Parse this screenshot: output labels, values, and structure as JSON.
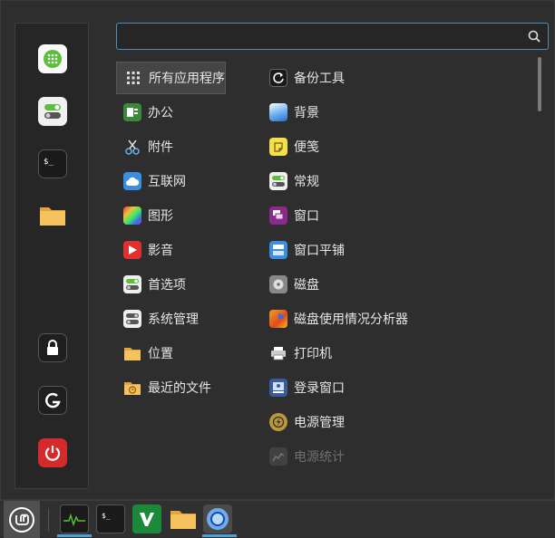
{
  "search": {
    "placeholder": "",
    "value": ""
  },
  "favorites": [
    {
      "name": "calculator",
      "icon": "calculator-icon"
    },
    {
      "name": "settings",
      "icon": "toggle-settings-icon"
    },
    {
      "name": "terminal",
      "icon": "terminal-icon"
    },
    {
      "name": "files",
      "icon": "folder-icon"
    }
  ],
  "system_buttons": [
    {
      "name": "lock",
      "icon": "lock-icon"
    },
    {
      "name": "logout",
      "icon": "logout-icon"
    },
    {
      "name": "shutdown",
      "icon": "power-icon"
    }
  ],
  "categories": [
    {
      "label": "所有应用程序",
      "icon": "grid-icon",
      "active": true
    },
    {
      "label": "办公",
      "icon": "office-icon"
    },
    {
      "label": "附件",
      "icon": "scissors-icon"
    },
    {
      "label": "互联网",
      "icon": "cloud-icon"
    },
    {
      "label": "图形",
      "icon": "graphics-icon"
    },
    {
      "label": "影音",
      "icon": "play-icon"
    },
    {
      "label": "首选项",
      "icon": "preferences-icon"
    },
    {
      "label": "系统管理",
      "icon": "system-admin-icon"
    },
    {
      "label": "位置",
      "icon": "folder-icon"
    },
    {
      "label": "最近的文件",
      "icon": "recent-folder-icon"
    }
  ],
  "apps": [
    {
      "label": "备份工具",
      "icon": "backup-icon"
    },
    {
      "label": "背景",
      "icon": "background-icon"
    },
    {
      "label": "便笺",
      "icon": "sticky-note-icon"
    },
    {
      "label": "常规",
      "icon": "general-icon"
    },
    {
      "label": "窗口",
      "icon": "windows-icon"
    },
    {
      "label": "窗口平铺",
      "icon": "window-tiling-icon"
    },
    {
      "label": "磁盘",
      "icon": "disk-icon"
    },
    {
      "label": "磁盘使用情况分析器",
      "icon": "disk-usage-icon"
    },
    {
      "label": "打印机",
      "icon": "printer-icon"
    },
    {
      "label": "登录窗口",
      "icon": "login-window-icon"
    },
    {
      "label": "电源管理",
      "icon": "power-management-icon"
    },
    {
      "label": "电源统计",
      "icon": "power-statistics-icon"
    }
  ],
  "taskbar": [
    {
      "name": "system-monitor",
      "icon": "system-monitor-icon",
      "active": true
    },
    {
      "name": "terminal",
      "icon": "terminal-icon"
    },
    {
      "name": "vim",
      "icon": "vim-icon"
    },
    {
      "name": "files",
      "icon": "folder-icon"
    },
    {
      "name": "browser",
      "icon": "browser-icon",
      "active": true
    }
  ],
  "colors": {
    "accent": "#4aa3d8",
    "panel": "#303030",
    "menu_bg": "#2e2e2e"
  }
}
